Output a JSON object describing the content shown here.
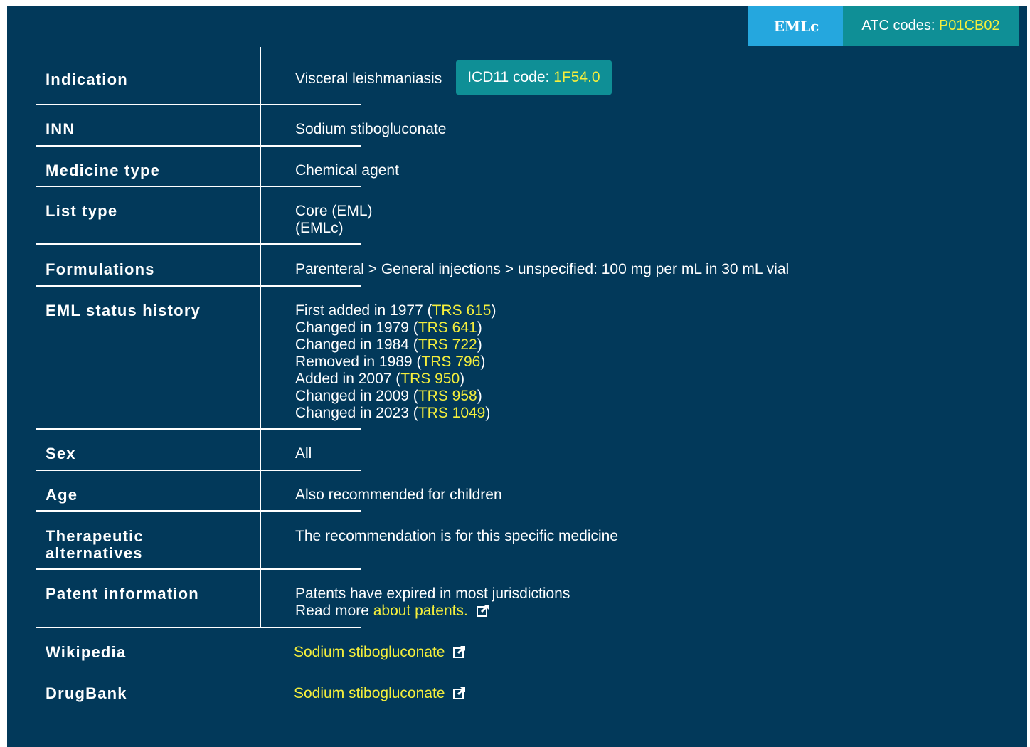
{
  "badges": {
    "emlc": "EMLc",
    "atc_label": "ATC codes: ",
    "atc_code": "P01CB02"
  },
  "indication": {
    "label": "Indication",
    "value": "Visceral leishmaniasis",
    "icd_label": "ICD11 code: ",
    "icd_code": "1F54.0"
  },
  "inn": {
    "label": "INN",
    "value": "Sodium stibogluconate"
  },
  "medicine_type": {
    "label": "Medicine type",
    "value": "Chemical agent"
  },
  "list_type": {
    "label": "List type",
    "line1": "Core (EML)",
    "line2": "(EMLc)"
  },
  "formulations": {
    "label": "Formulations",
    "value": "Parenteral > General injections > unspecified: 100 mg per mL in 30 mL vial"
  },
  "status_history": {
    "label": "EML status history",
    "entries": [
      {
        "text": "First added in 1977 (",
        "trs": "TRS 615"
      },
      {
        "text": "Changed in 1979 (",
        "trs": "TRS 641"
      },
      {
        "text": "Changed in 1984 (",
        "trs": "TRS 722"
      },
      {
        "text": "Removed in 1989 (",
        "trs": "TRS 796"
      },
      {
        "text": "Added in 2007 (",
        "trs": "TRS 950"
      },
      {
        "text": "Changed in 2009 (",
        "trs": "TRS 958"
      },
      {
        "text": "Changed in 2023 (",
        "trs": "TRS 1049"
      }
    ],
    "close": ")"
  },
  "sex": {
    "label": "Sex",
    "value": "All"
  },
  "age": {
    "label": "Age",
    "value": "Also recommended for children"
  },
  "therapeutic": {
    "label_line1": "Therapeutic",
    "label_line2": "alternatives",
    "value": "The recommendation is for this specific medicine"
  },
  "patent": {
    "label": "Patent information",
    "line1": "Patents have expired in most jurisdictions",
    "line2_prefix": "Read more ",
    "link": "about patents."
  },
  "wikipedia": {
    "label": "Wikipedia",
    "link": "Sodium stibogluconate"
  },
  "drugbank": {
    "label": "DrugBank",
    "link": "Sodium stibogluconate"
  },
  "colors": {
    "panel": "#02395a",
    "accent_link": "#f5ef3c",
    "emlc_badge": "#25a7de",
    "teal_badge": "#0f8f96"
  }
}
